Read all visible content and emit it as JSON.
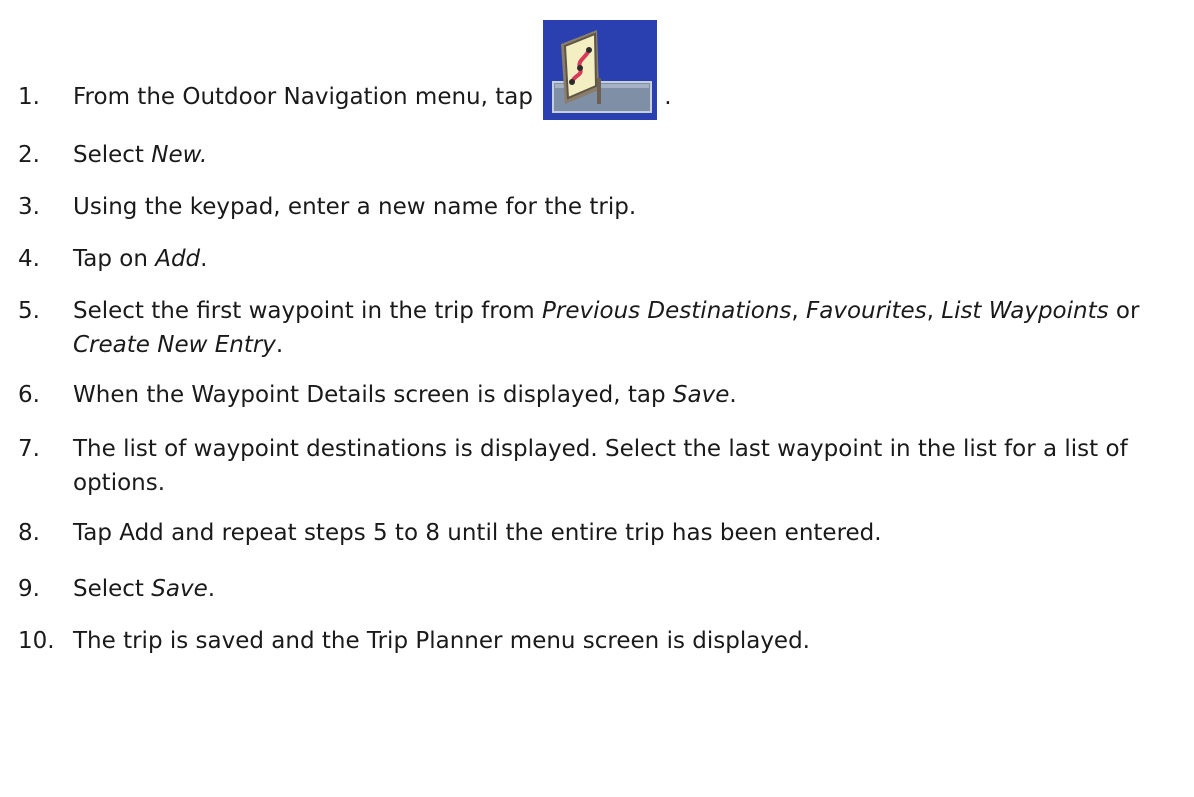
{
  "icon": {
    "name": "trip-planner-icon"
  },
  "steps": [
    {
      "num": "1.",
      "parts": [
        {
          "t": "From the Outdoor Navigation menu, tap"
        },
        {
          "icon": true
        },
        {
          "t": " ."
        }
      ]
    },
    {
      "num": "2.",
      "parts": [
        {
          "t": "Select "
        },
        {
          "i": "New."
        }
      ]
    },
    {
      "num": "3.",
      "parts": [
        {
          "t": "Using the keypad, enter a new name for the trip."
        }
      ]
    },
    {
      "num": "4.",
      "parts": [
        {
          "t": "Tap on "
        },
        {
          "i": "Add"
        },
        {
          "t": "."
        }
      ]
    },
    {
      "num": "5.",
      "parts": [
        {
          "t": "Select the first waypoint in the trip from "
        },
        {
          "i": "Previous Destinations"
        },
        {
          "t": ", "
        },
        {
          "i": "Favourites"
        },
        {
          "t": ", "
        },
        {
          "i": "List Waypoints"
        },
        {
          "t": " or "
        },
        {
          "i": "Create New Entry"
        },
        {
          "t": "."
        }
      ]
    },
    {
      "num": "6.",
      "parts": [
        {
          "t": "When the Waypoint Details screen is displayed, tap "
        },
        {
          "i": "Save"
        },
        {
          "t": "."
        }
      ]
    },
    {
      "num": "7.",
      "parts": [
        {
          "t": "The list of waypoint destinations is displayed. Select the last waypoint in the list for a list of options."
        }
      ]
    },
    {
      "num": "8.",
      "parts": [
        {
          "t": "Tap Add and repeat steps 5 to 8 until the entire trip has been entered."
        }
      ]
    },
    {
      "num": "9.",
      "parts": [
        {
          "t": "Select "
        },
        {
          "i": "Save"
        },
        {
          "t": "."
        }
      ]
    },
    {
      "num": "10.",
      "parts": [
        {
          "t": "The trip is saved and the Trip Planner menu screen is displayed."
        }
      ]
    }
  ]
}
